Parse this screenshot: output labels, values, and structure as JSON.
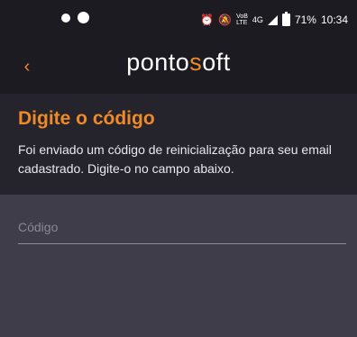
{
  "status_bar": {
    "net_label_top": "VoB",
    "net_label_bottom": "LTE",
    "network": "4G",
    "battery_text": "71%",
    "time": "10:34"
  },
  "app_bar": {
    "back_glyph": "‹",
    "logo": {
      "part1": "ponto",
      "part2": "s",
      "part3": "oft",
      "accent_color": "#f08a27"
    }
  },
  "header": {
    "title": "Digite o código",
    "description": "Foi enviado um código de reinicialização para seu email cadastrado. Digite-o no campo abaixo."
  },
  "form": {
    "code_placeholder": "Código",
    "code_value": ""
  },
  "colors": {
    "accent": "#f08a27",
    "app_bar_bg": "#1c1b21",
    "body_bg": "#3f3d4a"
  }
}
